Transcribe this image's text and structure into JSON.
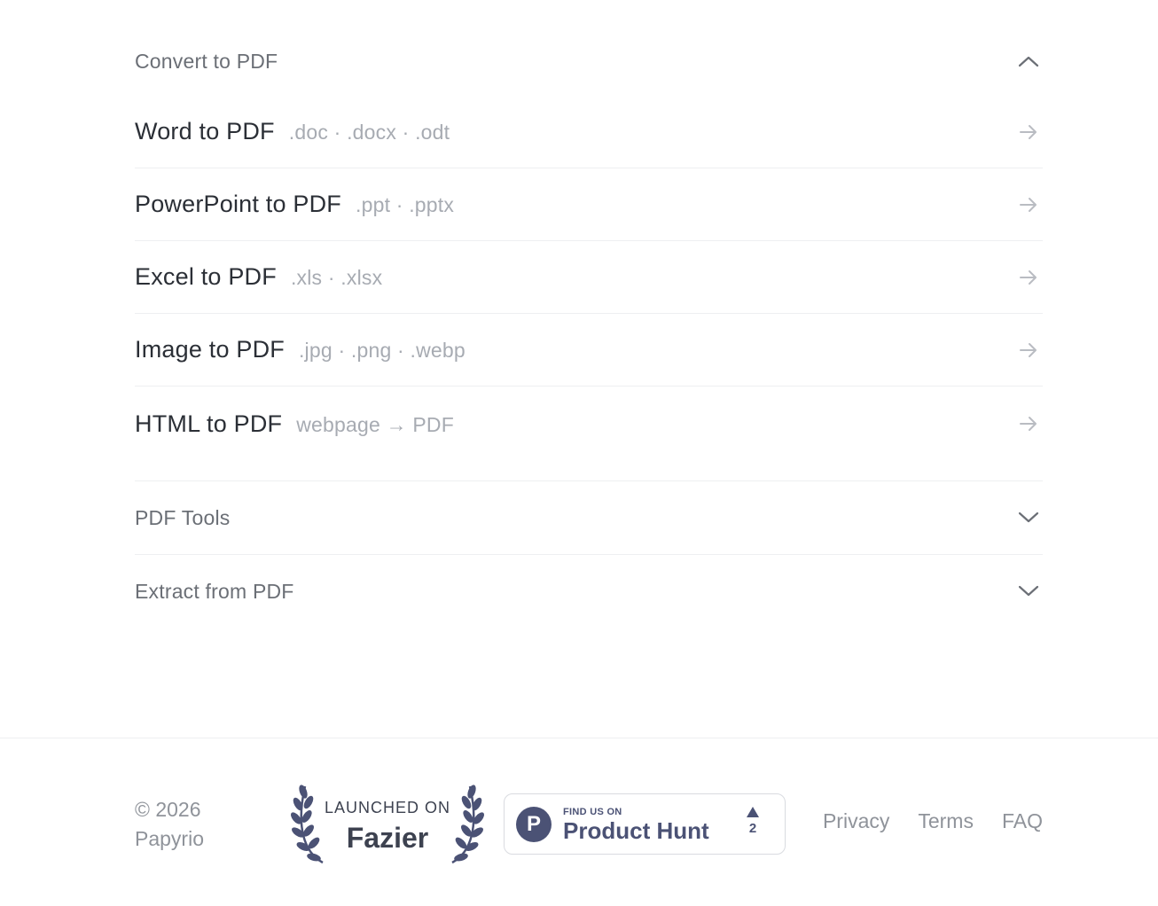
{
  "sections": {
    "convert": {
      "title": "Convert to PDF",
      "expanded": true,
      "tools": [
        {
          "name": "Word to PDF",
          "ext": ".doc · .docx · .odt"
        },
        {
          "name": "PowerPoint to PDF",
          "ext": ".ppt · .pptx"
        },
        {
          "name": "Excel to PDF",
          "ext": ".xls · .xlsx"
        },
        {
          "name": "Image to PDF",
          "ext": ".jpg · .png · .webp"
        },
        {
          "name": "HTML to PDF",
          "ext": "webpage → PDF"
        }
      ]
    },
    "pdf_tools": {
      "title": "PDF Tools",
      "expanded": false
    },
    "extract": {
      "title": "Extract from PDF",
      "expanded": false
    }
  },
  "footer": {
    "copyright_line1": "© 2026",
    "copyright_line2": "Papyrio",
    "fazier": {
      "launched": "LAUNCHED ON",
      "brand": "Fazier"
    },
    "product_hunt": {
      "small": "FIND US ON",
      "big": "Product Hunt",
      "logo_letter": "P",
      "votes": "2"
    },
    "links": {
      "privacy": "Privacy",
      "terms": "Terms",
      "faq": "FAQ"
    }
  },
  "icons": {
    "expanded": "chevron-up-icon",
    "collapsed": "chevron-down-icon",
    "row": "arrow-right-icon"
  },
  "colors": {
    "text": "#2b2f36",
    "muted": "#a7abb2",
    "product_hunt": "#4b5275"
  }
}
